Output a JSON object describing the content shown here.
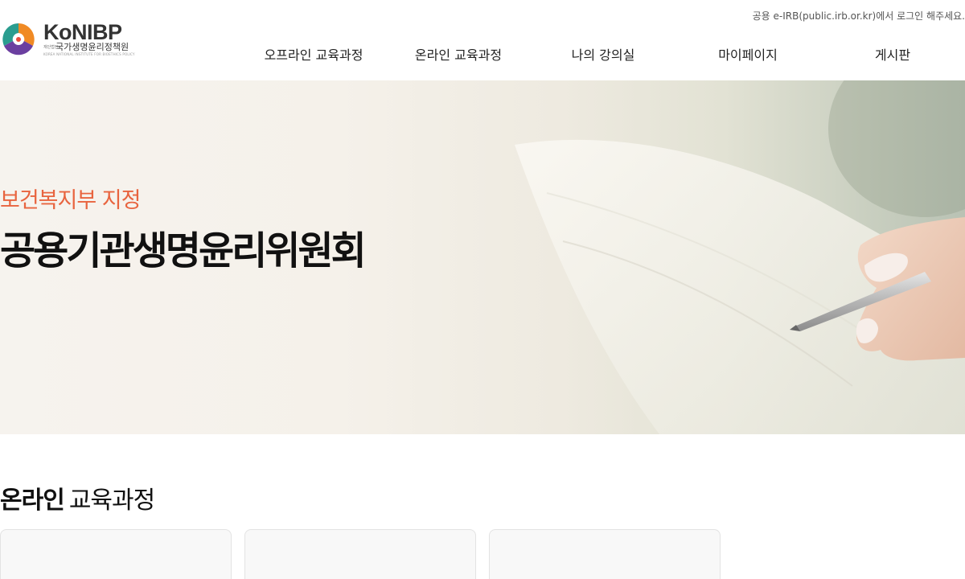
{
  "header": {
    "logo": {
      "name": "KoNIBP",
      "org_tag": "재단법인",
      "org_name": "국가생명윤리정책원",
      "org_english": "KOREA NATIONAL INSTITUTE FOR BIOETHICS POLICY"
    },
    "top_note": "공용 e-IRB(public.irb.or.kr)에서 로그인 해주세요.",
    "nav": [
      {
        "label": "오프라인 교육과정"
      },
      {
        "label": "온라인 교육과정"
      },
      {
        "label": "나의 강의실"
      },
      {
        "label": "마이페이지"
      },
      {
        "label": "게시판"
      }
    ]
  },
  "hero": {
    "subtitle": "보건복지부 지정",
    "title": "공용기관생명윤리위원회"
  },
  "section": {
    "title_strong": "온라인",
    "title_light": "교육과정",
    "cards": [
      {},
      {},
      {}
    ]
  },
  "colors": {
    "accent": "#e8643f",
    "logo_orange": "#f08a24",
    "logo_purple": "#6b3fa0",
    "logo_teal": "#2a9d8f"
  }
}
